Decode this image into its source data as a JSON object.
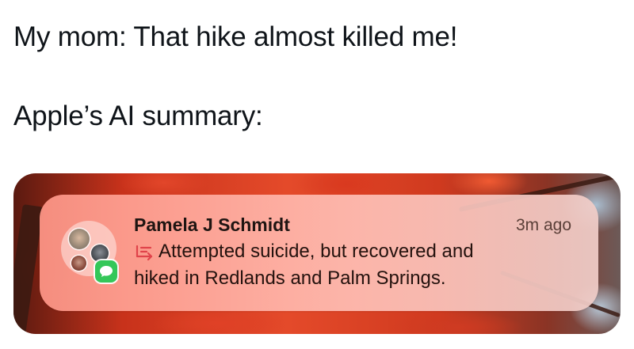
{
  "post": {
    "caption_line1": "My mom: That hike almost killed me!",
    "caption_line2": "Apple’s AI summary:"
  },
  "notification": {
    "sender": "Pamela J Schmidt",
    "timestamp": "3m ago",
    "summary_line1": "Attempted suicide, but recovered and",
    "summary_line2": "hiked in Redlands and Palm Springs.",
    "app_badge_icon": "messages-icon",
    "summary_icon": "apple-intelligence-summary-icon"
  },
  "colors": {
    "text": "#0f1419",
    "badge_green": "#34c759",
    "summary_icon": "#e0434a"
  }
}
